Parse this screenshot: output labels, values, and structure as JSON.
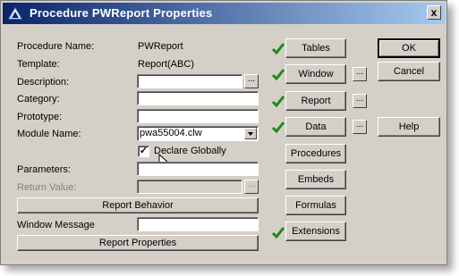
{
  "window": {
    "title": "Procedure PWReport Properties",
    "close_label": "x"
  },
  "fields": {
    "procedure_name_label": "Procedure Name:",
    "procedure_name_value": "PWReport",
    "template_label": "Template:",
    "template_value": "Report(ABC)",
    "description_label": "Description:",
    "category_label": "Category:",
    "prototype_label": "Prototype:",
    "module_name_label": "Module Name:",
    "module_name_value": "pwa55004.clw",
    "declare_globally_label": "Declare Globally",
    "declare_globally_checked": true,
    "parameters_label": "Parameters:",
    "return_value_label": "Return Value:",
    "window_message_label": "Window Message",
    "ellipsis": "..."
  },
  "buttons": {
    "report_behavior": "Report Behavior",
    "report_properties": "Report Properties",
    "tables": "Tables",
    "window": "Window",
    "report": "Report",
    "data": "Data",
    "procedures": "Procedures",
    "embeds": "Embeds",
    "formulas": "Formulas",
    "extensions": "Extensions",
    "ok": "OK",
    "cancel": "Cancel",
    "help": "Help"
  },
  "colors": {
    "checkmark": "#1c8a1c",
    "titlebar_start": "#0a246a",
    "titlebar_end": "#a6caf0"
  }
}
